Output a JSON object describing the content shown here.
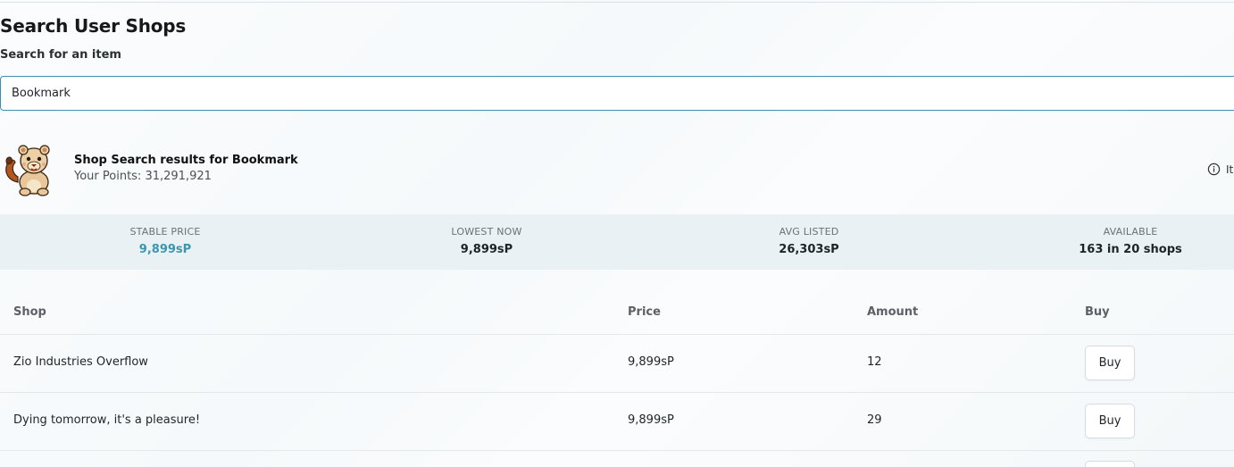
{
  "page": {
    "title": "Search User Shops",
    "search_label": "Search for an item",
    "search_value": "Bookmark"
  },
  "results": {
    "title": "Shop Search results for Bookmark",
    "points_text": "Your Points: 31,291,921",
    "info_label": "It"
  },
  "stats": [
    {
      "label": "STABLE PRICE",
      "value": "9,899sP"
    },
    {
      "label": "LOWEST NOW",
      "value": "9,899sP"
    },
    {
      "label": "AVG LISTED",
      "value": "26,303sP"
    },
    {
      "label": "AVAILABLE",
      "value": "163 in 20 shops"
    }
  ],
  "table": {
    "headers": [
      "Shop",
      "Price",
      "Amount",
      "Buy"
    ],
    "rows": [
      {
        "shop": "Zio Industries Overflow",
        "price": "9,899sP",
        "amount": "12",
        "buy": "Buy"
      },
      {
        "shop": "Dying tomorrow, it's a pleasure!",
        "price": "9,899sP",
        "amount": "29",
        "buy": "Buy"
      }
    ]
  },
  "icons": {
    "mascot": "lion-cub-mascot-icon",
    "info": "info-circle-icon"
  },
  "colors": {
    "accent": "#3a97ad",
    "input_border": "#3f8fb0",
    "stats_background": "#e9f1f5"
  }
}
